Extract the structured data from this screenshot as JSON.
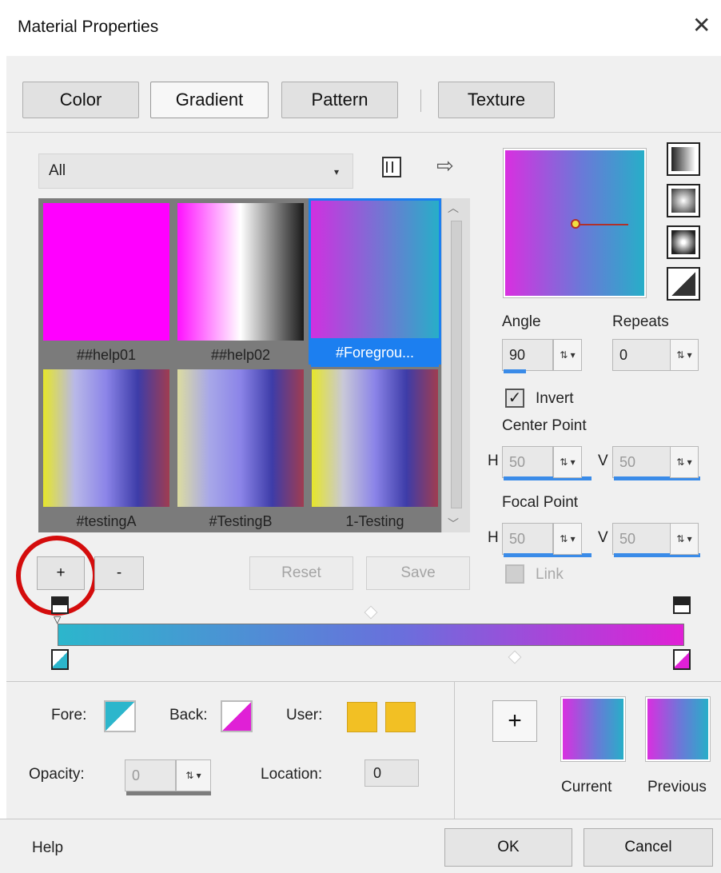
{
  "window": {
    "title": "Material Properties",
    "close_glyph": "✕"
  },
  "tabs": [
    {
      "label": "Color",
      "active": false
    },
    {
      "label": "Gradient",
      "active": true
    },
    {
      "label": "Pattern",
      "active": false
    },
    {
      "label": "Texture",
      "active": false
    }
  ],
  "filter": {
    "selected": "All",
    "arrow": "▾"
  },
  "icons": {
    "view_list": "list-view-icon",
    "export": "arrow-right-icon"
  },
  "gradients": [
    {
      "label": "##help01",
      "colors": [
        "#ff00ff",
        "#ff00ff"
      ]
    },
    {
      "label": "##help02",
      "colors": [
        "#ff10ff",
        "#ffffff",
        "#1a1a1a"
      ]
    },
    {
      "label": "#Foregrou...",
      "colors": [
        "#d030e0",
        "#27aec8"
      ],
      "selected": true
    },
    {
      "label": "#testingA",
      "colors": [
        "#e6e62a",
        "#b8b8e8",
        "#8b84e8",
        "#3d3ca8",
        "#a03c50"
      ]
    },
    {
      "label": "#TestingB",
      "colors": [
        "#dcdca0",
        "#a8a8e8",
        "#8b84e8",
        "#3d3ca8",
        "#a03c50"
      ]
    },
    {
      "label": "1-Testing",
      "colors": [
        "#e6e62a",
        "#c8c8d8",
        "#8b84e8",
        "#3d3ca8",
        "#a03c50"
      ]
    }
  ],
  "list_buttons": {
    "add": "+",
    "remove": "-",
    "reset": "Reset",
    "save": "Save"
  },
  "style_buttons": [
    "linear-style-icon",
    "rectangular-style-icon",
    "radial-style-icon",
    "sunburst-style-icon"
  ],
  "angle": {
    "label": "Angle",
    "value": "90"
  },
  "repeats": {
    "label": "Repeats",
    "value": "0"
  },
  "invert": {
    "label": "Invert",
    "checked": true
  },
  "center_point": {
    "label": "Center Point",
    "h_label": "H",
    "h_value": "50",
    "v_label": "V",
    "v_value": "50"
  },
  "focal_point": {
    "label": "Focal Point",
    "h_label": "H",
    "h_value": "50",
    "v_label": "V",
    "v_value": "50"
  },
  "link": {
    "label": "Link",
    "checked": false
  },
  "color_sources": {
    "fore_label": "Fore:",
    "back_label": "Back:",
    "user_label": "User:"
  },
  "opacity": {
    "label": "Opacity:",
    "value": "0"
  },
  "location": {
    "label": "Location:",
    "value": "0"
  },
  "history": {
    "add": "+",
    "current_label": "Current",
    "previous_label": "Previous"
  },
  "footer": {
    "help": "Help",
    "ok": "OK",
    "cancel": "Cancel"
  },
  "colors": {
    "accent": "#1c7ff0",
    "highlight_circle": "#d40c0c",
    "user_color": "#f2c024"
  }
}
